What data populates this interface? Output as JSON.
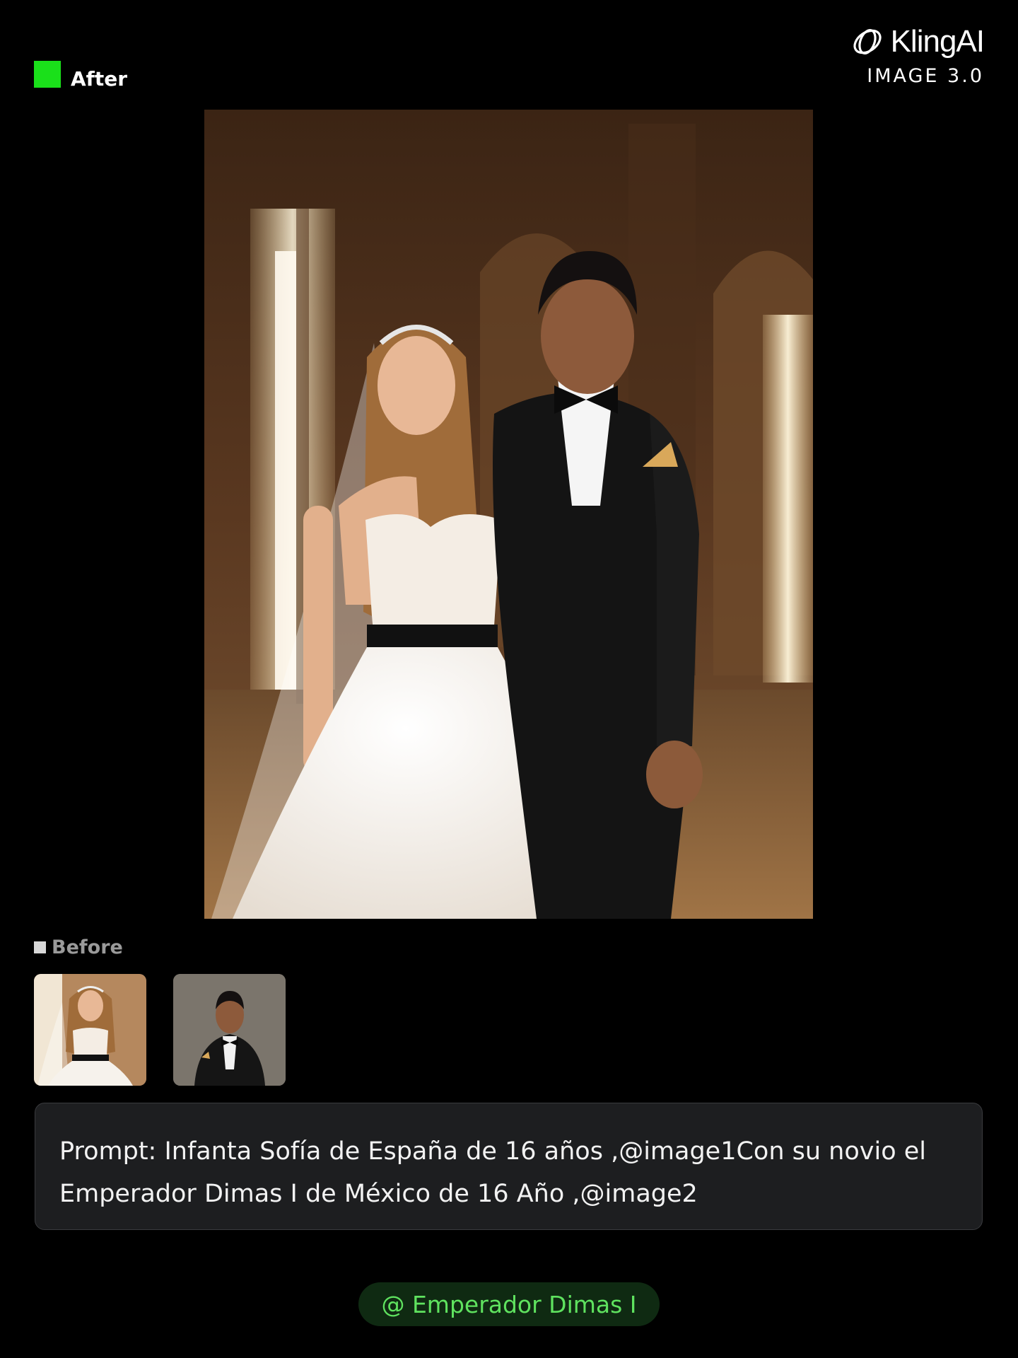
{
  "header": {
    "after_label": "After",
    "brand_name": "KlingAI",
    "brand_subtitle": "IMAGE 3.0",
    "logo_icon": "kling-logo-icon",
    "accent_color": "#1ae01a"
  },
  "main_image": {
    "description_icon": "generated-wedding-photo"
  },
  "before": {
    "label": "Before",
    "thumbnails": [
      {
        "name": "image1"
      },
      {
        "name": "image2"
      }
    ]
  },
  "prompt": {
    "text": "Prompt: Infanta Sofía de España de 16 años ,@image1Con su novio el Emperador Dimas I de México de 16 Año ,@image2"
  },
  "mention": {
    "label": "@ Emperador Dimas I",
    "color": "#5fe25f"
  }
}
